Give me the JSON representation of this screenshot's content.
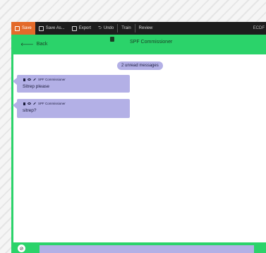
{
  "menubar": {
    "items": [
      {
        "label": "Save",
        "active": true
      },
      {
        "label": "Save As..."
      },
      {
        "label": "Export"
      },
      {
        "label": "Undo"
      },
      {
        "label": "Train"
      },
      {
        "label": "Review"
      }
    ],
    "right_text": "ECDF"
  },
  "header": {
    "back_label": "Back",
    "title": "SPF Commissioner"
  },
  "unread_badge": "2 unread messages",
  "messages": [
    {
      "sender": "SPF Commissioner",
      "text": "Sitrep please"
    },
    {
      "sender": "SPF Commissioner",
      "text": "sitrep?"
    }
  ],
  "composer": {
    "attach_icon": "paperclip-icon",
    "placeholder": ""
  },
  "colors": {
    "accent_green": "#2bd36a",
    "bubble": "#b3b0e6",
    "menubar": "#1d1d1d",
    "active_menu": "#e36a2a"
  }
}
